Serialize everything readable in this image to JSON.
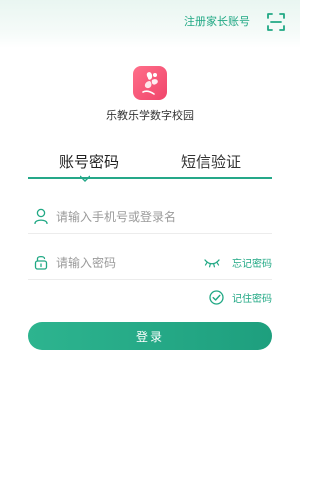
{
  "header": {
    "register_label": "注册家长账号",
    "scan_icon": "scan-icon"
  },
  "brand": {
    "logo_icon": "flower-logo-icon",
    "school_name": "乐教乐学数字校园"
  },
  "tabs": [
    {
      "label": "账号密码",
      "active": true
    },
    {
      "label": "短信验证",
      "active": false
    }
  ],
  "form": {
    "phone_placeholder": "请输入手机号或登录名",
    "password_placeholder": "请输入密码",
    "forgot_label": "忘记密码",
    "remember_label": "记住密码",
    "remember_checked": true,
    "login_label": "登录"
  },
  "colors": {
    "accent": "#20a884",
    "logo": "#f0456b"
  }
}
